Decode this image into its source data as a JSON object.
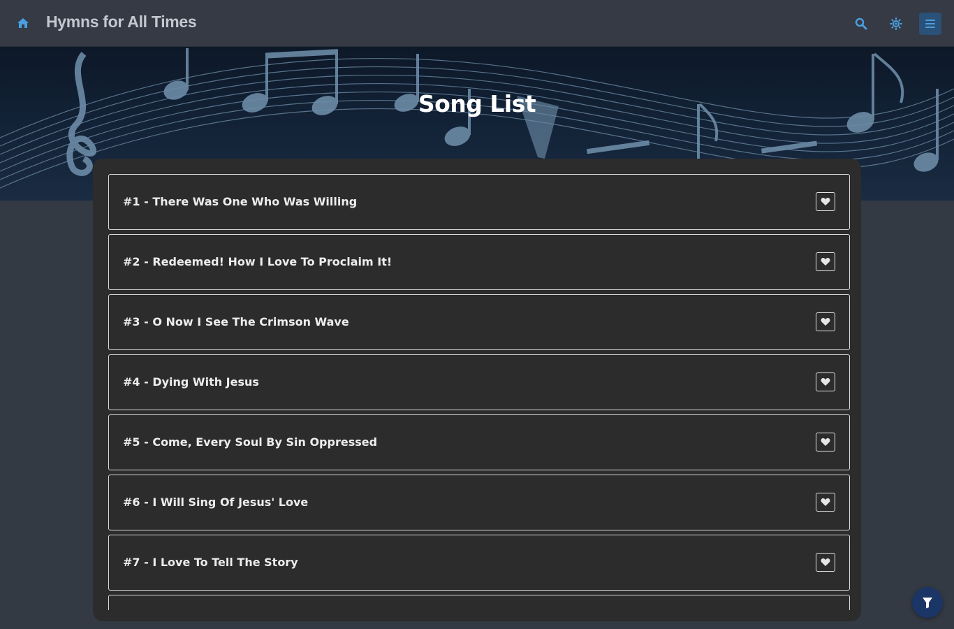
{
  "navbar": {
    "brand": "Hymns for All Times",
    "home_icon": "home-icon",
    "search_icon": "search-icon",
    "theme_icon": "sun-icon",
    "menu_icon": "hamburger-menu-icon"
  },
  "banner": {
    "title": "Song List"
  },
  "songs": [
    {
      "label": "#1 - There Was One Who Was Willing"
    },
    {
      "label": "#2 - Redeemed! How I Love To Proclaim It!"
    },
    {
      "label": "#3 - O Now I See The Crimson Wave"
    },
    {
      "label": "#4 - Dying With Jesus"
    },
    {
      "label": "#5 - Come, Every Soul By Sin Oppressed"
    },
    {
      "label": "#6 - I Will Sing Of Jesus' Love"
    },
    {
      "label": "#7 - I Love To Tell The Story"
    },
    {
      "label": ""
    }
  ],
  "fab": {
    "icon": "filter-icon"
  },
  "colors": {
    "accent": "#4a9fe0",
    "navbar": "#353a45",
    "panel": "#2c2c2c",
    "fab": "#1b3566",
    "menu_button": "#2a5178"
  }
}
